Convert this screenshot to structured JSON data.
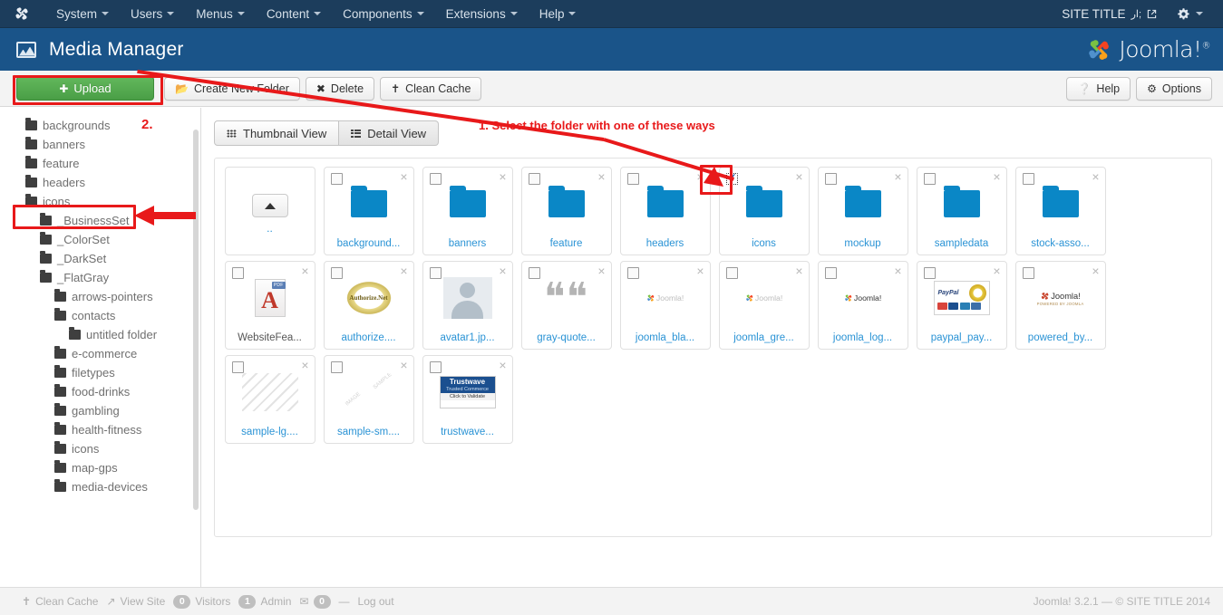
{
  "topbar": {
    "brand_icon": "joomla-mark-icon",
    "menu": [
      {
        "label": "System",
        "icon": "chevron-down-icon"
      },
      {
        "label": "Users",
        "icon": "chevron-down-icon"
      },
      {
        "label": "Menus",
        "icon": "chevron-down-icon"
      },
      {
        "label": "Content",
        "icon": "chevron-down-icon"
      },
      {
        "label": "Components",
        "icon": "chevron-down-icon"
      },
      {
        "label": "Extensions",
        "icon": "chevron-down-icon"
      },
      {
        "label": "Help",
        "icon": "chevron-down-icon"
      }
    ],
    "site_title": "SITE TITLE",
    "site_title_icon": "external-link-icon",
    "gear_icon": "gear-icon"
  },
  "header": {
    "icon": "image-icon",
    "title": "Media Manager",
    "logo_text": "Joomla!",
    "logo_sup": "®"
  },
  "toolbar": {
    "upload_label": "Upload",
    "upload_icon": "plus-circle-icon",
    "create_folder_label": "Create New Folder",
    "create_folder_icon": "folder-icon",
    "delete_label": "Delete",
    "delete_icon": "x-icon",
    "clean_cache_label": "Clean Cache",
    "clean_cache_icon": "broom-icon",
    "help_label": "Help",
    "help_icon": "question-circle-icon",
    "options_label": "Options",
    "options_icon": "gear-icon"
  },
  "tree": {
    "items": [
      {
        "label": "backgrounds",
        "indent": 0
      },
      {
        "label": "banners",
        "indent": 0
      },
      {
        "label": "feature",
        "indent": 0
      },
      {
        "label": "headers",
        "indent": 0
      },
      {
        "label": "icons",
        "indent": 0
      },
      {
        "label": "_BusinessSet",
        "indent": 1
      },
      {
        "label": "_ColorSet",
        "indent": 1
      },
      {
        "label": "_DarkSet",
        "indent": 1
      },
      {
        "label": "_FlatGray",
        "indent": 1
      },
      {
        "label": "arrows-pointers",
        "indent": 2
      },
      {
        "label": "contacts",
        "indent": 2
      },
      {
        "label": "untitled folder",
        "indent": 3
      },
      {
        "label": "e-commerce",
        "indent": 2
      },
      {
        "label": "filetypes",
        "indent": 2
      },
      {
        "label": "food-drinks",
        "indent": 2
      },
      {
        "label": "gambling",
        "indent": 2
      },
      {
        "label": "health-fitness",
        "indent": 2
      },
      {
        "label": "icons",
        "indent": 2
      },
      {
        "label": "map-gps",
        "indent": 2
      },
      {
        "label": "media-devices",
        "indent": 2
      }
    ]
  },
  "view_tabs": {
    "thumbnail_label": "Thumbnail View",
    "thumbnail_icon": "grid-icon",
    "detail_label": "Detail View",
    "detail_icon": "list-icon",
    "active": "Thumbnail View"
  },
  "thumbnails": [
    {
      "label": "..",
      "kind": "updir",
      "checked": false,
      "has_checkbox": false,
      "has_close": false
    },
    {
      "label": "background...",
      "kind": "folder",
      "checked": false,
      "has_checkbox": true,
      "has_close": true
    },
    {
      "label": "banners",
      "kind": "folder",
      "checked": false,
      "has_checkbox": true,
      "has_close": true
    },
    {
      "label": "feature",
      "kind": "folder",
      "checked": false,
      "has_checkbox": true,
      "has_close": true
    },
    {
      "label": "headers",
      "kind": "folder",
      "checked": false,
      "has_checkbox": true,
      "has_close": true
    },
    {
      "label": "icons",
      "kind": "folder",
      "checked": true,
      "has_checkbox": true,
      "has_close": true
    },
    {
      "label": "mockup",
      "kind": "folder",
      "checked": false,
      "has_checkbox": true,
      "has_close": true
    },
    {
      "label": "sampledata",
      "kind": "folder",
      "checked": false,
      "has_checkbox": true,
      "has_close": true
    },
    {
      "label": "stock-asso...",
      "kind": "folder",
      "checked": false,
      "has_checkbox": true,
      "has_close": true
    },
    {
      "label": "WebsiteFea...",
      "kind": "pdf",
      "checked": false,
      "has_checkbox": true,
      "has_close": true
    },
    {
      "label": "authorize....",
      "kind": "authorize",
      "checked": false,
      "has_checkbox": true,
      "has_close": true
    },
    {
      "label": "avatar1.jp...",
      "kind": "avatar",
      "checked": false,
      "has_checkbox": true,
      "has_close": true
    },
    {
      "label": "gray-quote...",
      "kind": "quote",
      "checked": false,
      "has_checkbox": true,
      "has_close": true
    },
    {
      "label": "joomla_bla...",
      "kind": "joomla-faded",
      "checked": false,
      "has_checkbox": true,
      "has_close": true
    },
    {
      "label": "joomla_gre...",
      "kind": "joomla-faded",
      "checked": false,
      "has_checkbox": true,
      "has_close": true
    },
    {
      "label": "joomla_log...",
      "kind": "joomla-dark",
      "checked": false,
      "has_checkbox": true,
      "has_close": true
    },
    {
      "label": "paypal_pay...",
      "kind": "paypal",
      "checked": false,
      "has_checkbox": true,
      "has_close": true
    },
    {
      "label": "powered_by...",
      "kind": "powered",
      "checked": false,
      "has_checkbox": true,
      "has_close": true
    },
    {
      "label": "sample-lg....",
      "kind": "sample",
      "checked": false,
      "has_checkbox": true,
      "has_close": true
    },
    {
      "label": "sample-sm....",
      "kind": "sample2",
      "checked": false,
      "has_checkbox": true,
      "has_close": true
    },
    {
      "label": "trustwave...",
      "kind": "trustwave",
      "checked": false,
      "has_checkbox": true,
      "has_close": true
    }
  ],
  "thumb_extra": {
    "pdf_tag": "PDF",
    "pdf_glyph": "A",
    "authorize_text": "Authorize.Net",
    "quote_glyph": "❝❝",
    "joomla_word": "Joomla!",
    "paypal_word": "PayPal",
    "powered_word": "Joomla!",
    "powered_sub": "POWERED BY JOOMLA",
    "trustwave_top": "Trustwave",
    "trustwave_mid": "Trusted Commerce",
    "trustwave_bot": "Click to Validate",
    "sample_wm1": "IMAGE",
    "sample_wm2": "SAMPLE"
  },
  "annotations": {
    "step1": "1.  Select the folder with one of these ways",
    "step2": "2.",
    "accent_color": "#e8191a"
  },
  "footer": {
    "clean_cache_label": "Clean Cache",
    "clean_cache_icon": "broom-icon",
    "view_site_label": "View Site",
    "view_site_icon": "external-link-icon",
    "visitors_count": "0",
    "visitors_label": "Visitors",
    "admin_count": "1",
    "admin_label": "Admin",
    "mail_icon": "envelope-icon",
    "mail_count": "0",
    "separator": "—",
    "logout_label": "Log out",
    "copyright": "Joomla! 3.2.1  —  © SITE TITLE 2014"
  }
}
